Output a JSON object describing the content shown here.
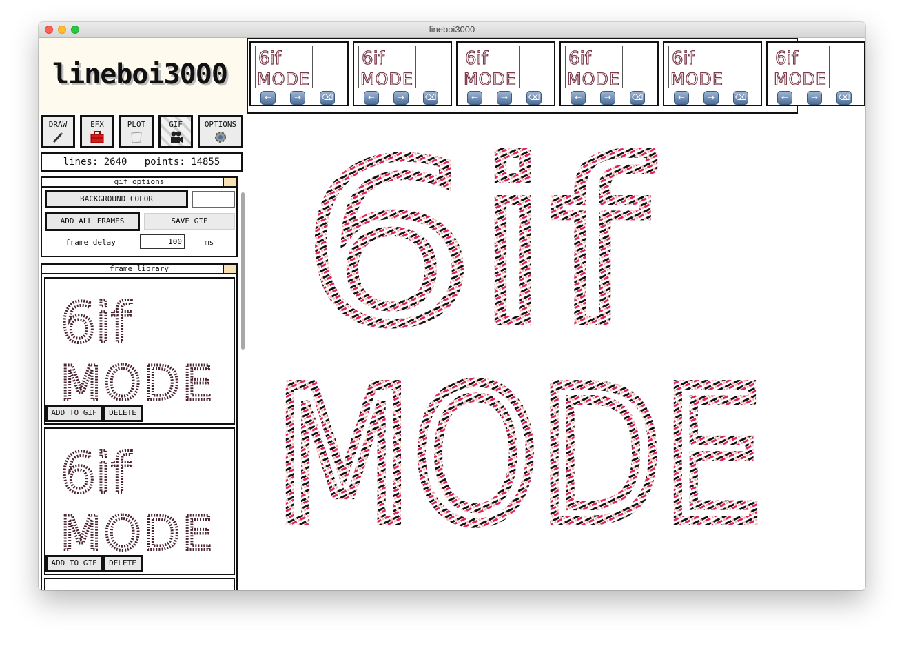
{
  "window": {
    "title": "lineboi3000"
  },
  "sidebar": {
    "logo": "lineboi3000",
    "tabs": [
      {
        "label": "DRAW",
        "icon": "pen-icon"
      },
      {
        "label": "EFX",
        "icon": "toolbox-icon"
      },
      {
        "label": "PLOT",
        "icon": "paper-icon"
      },
      {
        "label": "GIF",
        "icon": "camera-icon",
        "active": true
      },
      {
        "label": "OPTIONS",
        "icon": "gear-icon"
      }
    ],
    "counter": {
      "text": "lines: 2640   points: 14855"
    }
  },
  "gif_options": {
    "title": "gif options",
    "collapse": "−",
    "background_color_label": "BACKGROUND COLOR",
    "add_all_frames_label": "ADD ALL FRAMES",
    "save_gif_label": "SAVE GIF",
    "frame_delay_label": "frame delay",
    "frame_delay_value": "100",
    "frame_delay_unit": "ms"
  },
  "frame_library": {
    "title": "frame library",
    "collapse": "−",
    "frames": [
      {
        "text_line1": "6if",
        "text_line2": "MODE",
        "add_label": "ADD TO GIF",
        "delete_label": "DELETE"
      },
      {
        "text_line1": "6if",
        "text_line2": "MODE",
        "add_label": "ADD TO GIF",
        "delete_label": "DELETE"
      }
    ]
  },
  "gif_frames": [
    {
      "line1": "6if",
      "line2": "MODE"
    },
    {
      "line1": "6if",
      "line2": "MODE"
    },
    {
      "line1": "6if",
      "line2": "MODE"
    },
    {
      "line1": "6if",
      "line2": "MODE"
    },
    {
      "line1": "6if",
      "line2": "MODE"
    },
    {
      "line1": "6if",
      "line2": "MODE"
    }
  ],
  "nav_icons": {
    "prev": "←",
    "next": "→",
    "delete": "⌫"
  },
  "colors": {
    "ink": "#111111",
    "pink": "#e0245e",
    "peach": "#f4b8a8",
    "logo_bg": "#fffaee"
  }
}
